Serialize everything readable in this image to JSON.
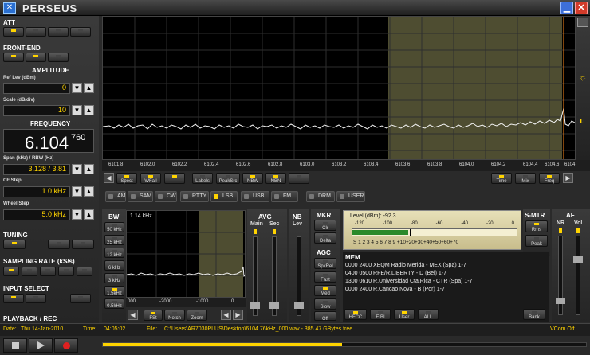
{
  "app": {
    "title": "PERSEUS"
  },
  "left": {
    "att": "ATT",
    "front_end": "FRONT-END",
    "amplitude": "AMPLITUDE",
    "ref_lev": "Ref Lev (dBm)",
    "ref_lev_value": "0",
    "scale": "Scale (dB/div)",
    "scale_value": "10",
    "frequency": "FREQUENCY",
    "freq_main": "6.104",
    "freq_sub": "760",
    "span_label": "Span (kHz) / RBW (Hz)",
    "span_value": "3.128 / 3.81",
    "cf_step": "CF Step",
    "cf_step_value": "1.0 kHz",
    "wheel_step": "Wheel Step",
    "wheel_step_value": "5.0 kHz",
    "tuning": "TUNING",
    "sampling": "SAMPLING RATE (kS/s)",
    "input_select": "INPUT SELECT",
    "playback": "PLAYBACK / REC"
  },
  "spectrum": {
    "ticks": [
      "6101.8",
      "6102.0",
      "6102.2",
      "6102.4",
      "6102.6",
      "6102.8",
      "6103.0",
      "6103.2",
      "6103.4",
      "6103.6",
      "6103.8",
      "6104.0",
      "6104.2",
      "6104.4",
      "6104.6",
      "6104"
    ],
    "buttons": [
      "Spect",
      "WFall",
      "",
      "Labels",
      "PeakSrc",
      "NBW",
      "NBN",
      ""
    ],
    "right_buttons": [
      "Time",
      "Mix",
      "Freq"
    ]
  },
  "modes": [
    "AM",
    "SAM",
    "CW",
    "RTTY",
    "LSB",
    "USB",
    "FM",
    "DRM",
    "USER"
  ],
  "bw": {
    "title": "BW",
    "value": "1.14 kHz",
    "items": [
      "50 kHz",
      "25 kHz",
      "12 kHz",
      "6 kHz",
      "3 kHz",
      "1.5kHz",
      "0.5kHz"
    ],
    "ticks": [
      "000",
      "-2000",
      "-1000",
      "0"
    ],
    "buttons": [
      "FSt",
      "Notch",
      "Zoom"
    ]
  },
  "avg": {
    "title": "AVG",
    "main": "Main",
    "sec": "Sec"
  },
  "nb": {
    "title": "NB",
    "lev": "Lev"
  },
  "mkr": {
    "title": "MKR",
    "clr": "Clr",
    "delta": "Delta"
  },
  "agc": {
    "title": "AGC",
    "items": [
      "SpkRel",
      "Fast",
      "Med",
      "Slow",
      "Off"
    ]
  },
  "smeter": {
    "level": "Level (dBm): -92.3",
    "top_scale": [
      "-120",
      "-100",
      "-80",
      "-60",
      "-40",
      "-20",
      "0"
    ],
    "bottom_scale": "S 1 2 3 4 5 6 7 8 9 +10+20+30+40+50+60+70",
    "title": "S-MTR",
    "rms": "Rms",
    "peak": "Peak"
  },
  "af": {
    "title": "AF",
    "nr": "NR",
    "vol": "Vol"
  },
  "mem": {
    "title": "MEM",
    "lines": [
      "0000 2400 XEQM Radio Merida   - MEX (Spa)   1-7",
      "0400 0500 RFE/R.LIBERTY   - D (Bel)   1-7",
      "1300 0610 R.Universidad Cta.Rica   - CTR (Spa)   1-7",
      "0000 2400 R.Cancao Nova   - B (Por)   1-7"
    ],
    "buttons": [
      "HFCC",
      "EIBI",
      "User",
      "ALL"
    ],
    "bank": "Bank"
  },
  "status": {
    "date_label": "Date:",
    "date_value": "Thu 14-Jan-2010",
    "time_label": "Time:",
    "time_value": "04:05:02",
    "file_label": "File:",
    "file_value": "C:\\Users\\AR7030PLUS\\Desktop\\6104.76kHz_000.wav - 385.47 GBytes free",
    "vcom": "VCom Off"
  },
  "colors": {
    "accent": "#ffd400",
    "passband": "#5c5a3a",
    "panel": "#2a2a2a"
  }
}
